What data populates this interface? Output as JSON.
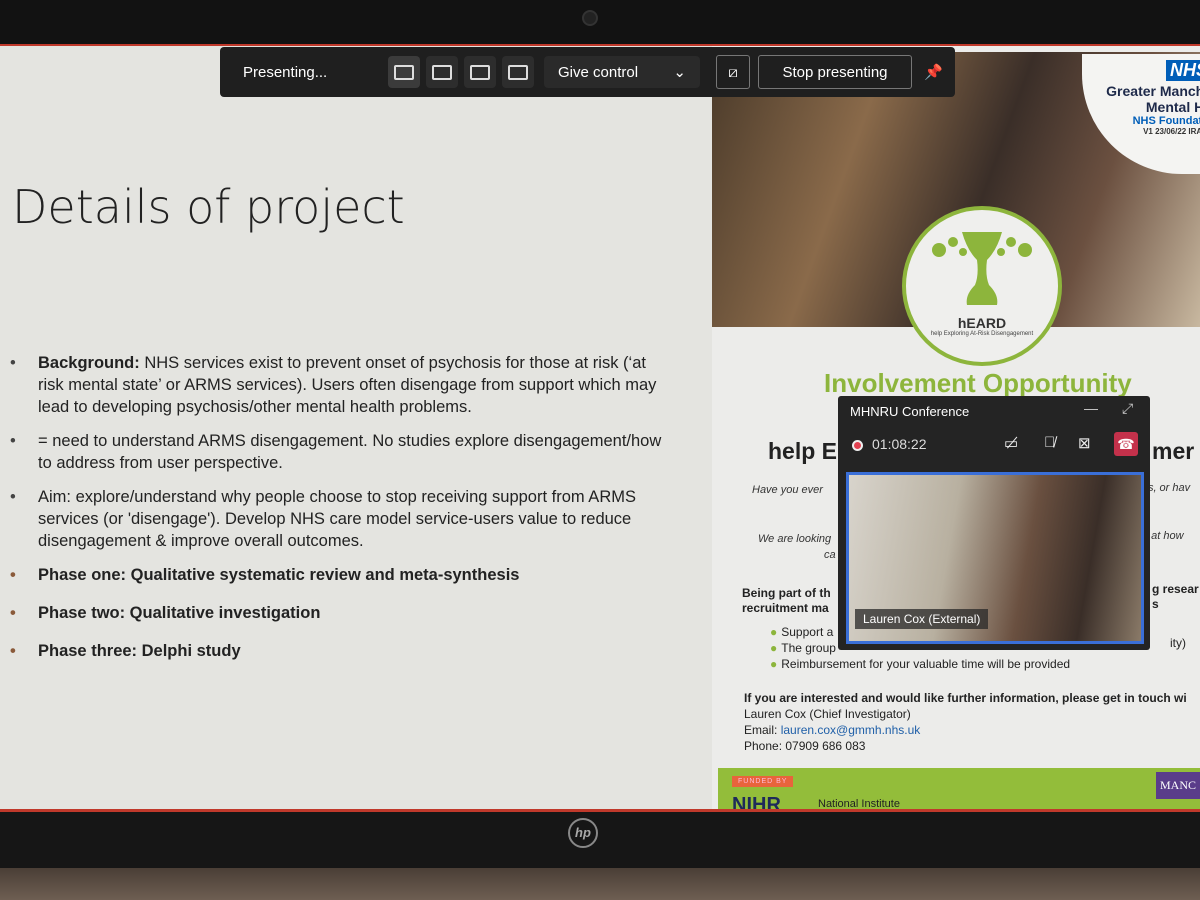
{
  "toolbar": {
    "status": "Presenting...",
    "give_control": "Give control",
    "stop_presenting": "Stop presenting",
    "layouts": [
      "content-only",
      "standout",
      "side-by-side",
      "reporter"
    ]
  },
  "slide": {
    "title": "Details of project",
    "bullets": [
      {
        "bold": "Background:",
        "text": " NHS services exist to prevent onset of psychosis for those at risk (‘at risk mental state’ or ARMS services). Users often disengage from support which may lead to developing psychosis/other mental health problems."
      },
      {
        "text": "= need to understand ARMS disengagement. No studies explore disengagement/how to address from user perspective."
      },
      {
        "text": "Aim: explore/understand why people choose to stop receiving support from ARMS services (or 'disengage'). Develop NHS care model service-users value to reduce disengagement & improve overall outcomes."
      },
      {
        "text": "Phase one: Qualitative systematic review and meta-synthesis"
      },
      {
        "text": "Phase two: Qualitative investigation"
      },
      {
        "text": "Phase three: Delphi study"
      }
    ]
  },
  "poster": {
    "nhs": "NHS",
    "org1": "Greater Manche",
    "org2": "Mental He",
    "org3": "NHS Foundatio",
    "version": "V1 23/06/22 IRAS I",
    "logo_name": "hEARD",
    "logo_tagline": "help Exploring At-Risk Disengagement",
    "heading": "Involvement Opportunity",
    "subheading": "help E",
    "subheading_end": "mer",
    "line1_start": "Have you ever",
    "line1_end": "sis, or hav",
    "line2_start": "We are looking",
    "line2_end": "g at how",
    "line2b": "ca",
    "being_part": "Being part of th",
    "recruit": "recruitment ma",
    "being_end": "g resear",
    "recruit_end": "s",
    "benefits": [
      "Support a",
      "The group",
      "Reimbursement for your valuable time will be provided"
    ],
    "benefit_end": "ity)",
    "contact_intro": "If you are interested and would like further information, please get in touch wi",
    "contact_name": "Lauren Cox (Chief Investigator)",
    "email_label": "Email: ",
    "email": "lauren.cox@gmmh.nhs.uk",
    "phone": "Phone: 07909 686 083",
    "funded_by": "FUNDED BY",
    "nihr": "NIHR",
    "national_institute": "National Institute",
    "university": "MANC"
  },
  "meeting": {
    "title": "MHNRU Conference",
    "timer": "01:08:22",
    "participant": "Lauren Cox (External)",
    "hangup_color": "#c4314b"
  },
  "device": {
    "brand": "hp"
  },
  "colors": {
    "accent_green": "#8db53c",
    "teams_bar": "#1f1f1f",
    "nhs_blue": "#005eb8"
  }
}
